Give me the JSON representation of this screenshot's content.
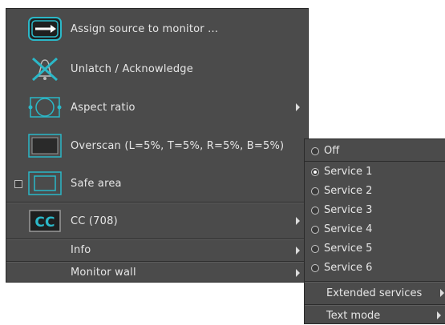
{
  "menu": {
    "items": [
      {
        "label": "Assign source to monitor ...",
        "icon": "assign-source-icon"
      },
      {
        "label": "Unlatch / Acknowledge",
        "icon": "unlatch-icon"
      },
      {
        "label": "Aspect ratio",
        "icon": "aspect-ratio-icon"
      },
      {
        "label": "Overscan (L=5%, T=5%, R=5%, B=5%)",
        "icon": "overscan-icon"
      },
      {
        "label": "Safe area",
        "icon": "safe-area-icon"
      },
      {
        "label": "CC (708)",
        "icon": "cc-icon",
        "icon_text": "CC"
      },
      {
        "label": "Info"
      },
      {
        "label": "Monitor wall"
      }
    ]
  },
  "submenu": {
    "options": [
      {
        "label": "Off",
        "selected": false
      },
      {
        "label": "Service 1",
        "selected": true
      },
      {
        "label": "Service 2",
        "selected": false
      },
      {
        "label": "Service 3",
        "selected": false
      },
      {
        "label": "Service 4",
        "selected": false
      },
      {
        "label": "Service 5",
        "selected": false
      },
      {
        "label": "Service 6",
        "selected": false
      }
    ],
    "extended": "Extended services",
    "text_mode": "Text mode"
  },
  "colors": {
    "menu_bg": "#4b4b4b",
    "icon_accent": "#2bb8c8",
    "text": "#e6e6e6"
  }
}
